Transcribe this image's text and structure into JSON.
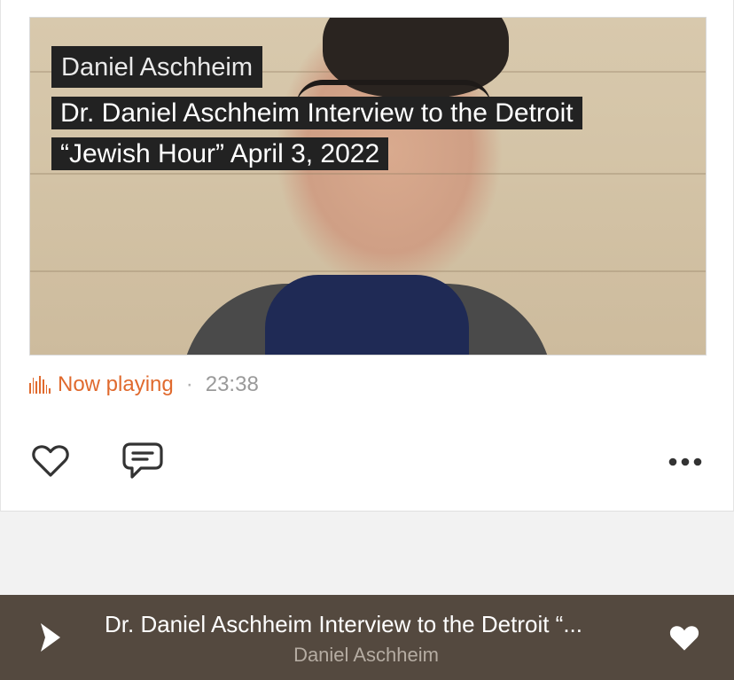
{
  "track": {
    "artist": "Daniel Aschheim",
    "title_line1": "Dr. Daniel Aschheim Interview to the Detroit",
    "title_line2": "“Jewish Hour” April 3, 2022"
  },
  "status": {
    "now_playing": "Now playing",
    "separator": "·",
    "duration": "23:38"
  },
  "actions": {
    "like_icon": "heart-outline-icon",
    "comment_icon": "comment-bubble-icon",
    "more_icon": "more-dots-icon"
  },
  "player": {
    "title": "Dr. Daniel Aschheim Interview to the Detroit “...",
    "artist": "Daniel Aschheim",
    "play_icon": "play-icon",
    "like_icon": "heart-filled-icon"
  },
  "colors": {
    "accent": "#e06a2e",
    "player_bg": "#54493f"
  }
}
